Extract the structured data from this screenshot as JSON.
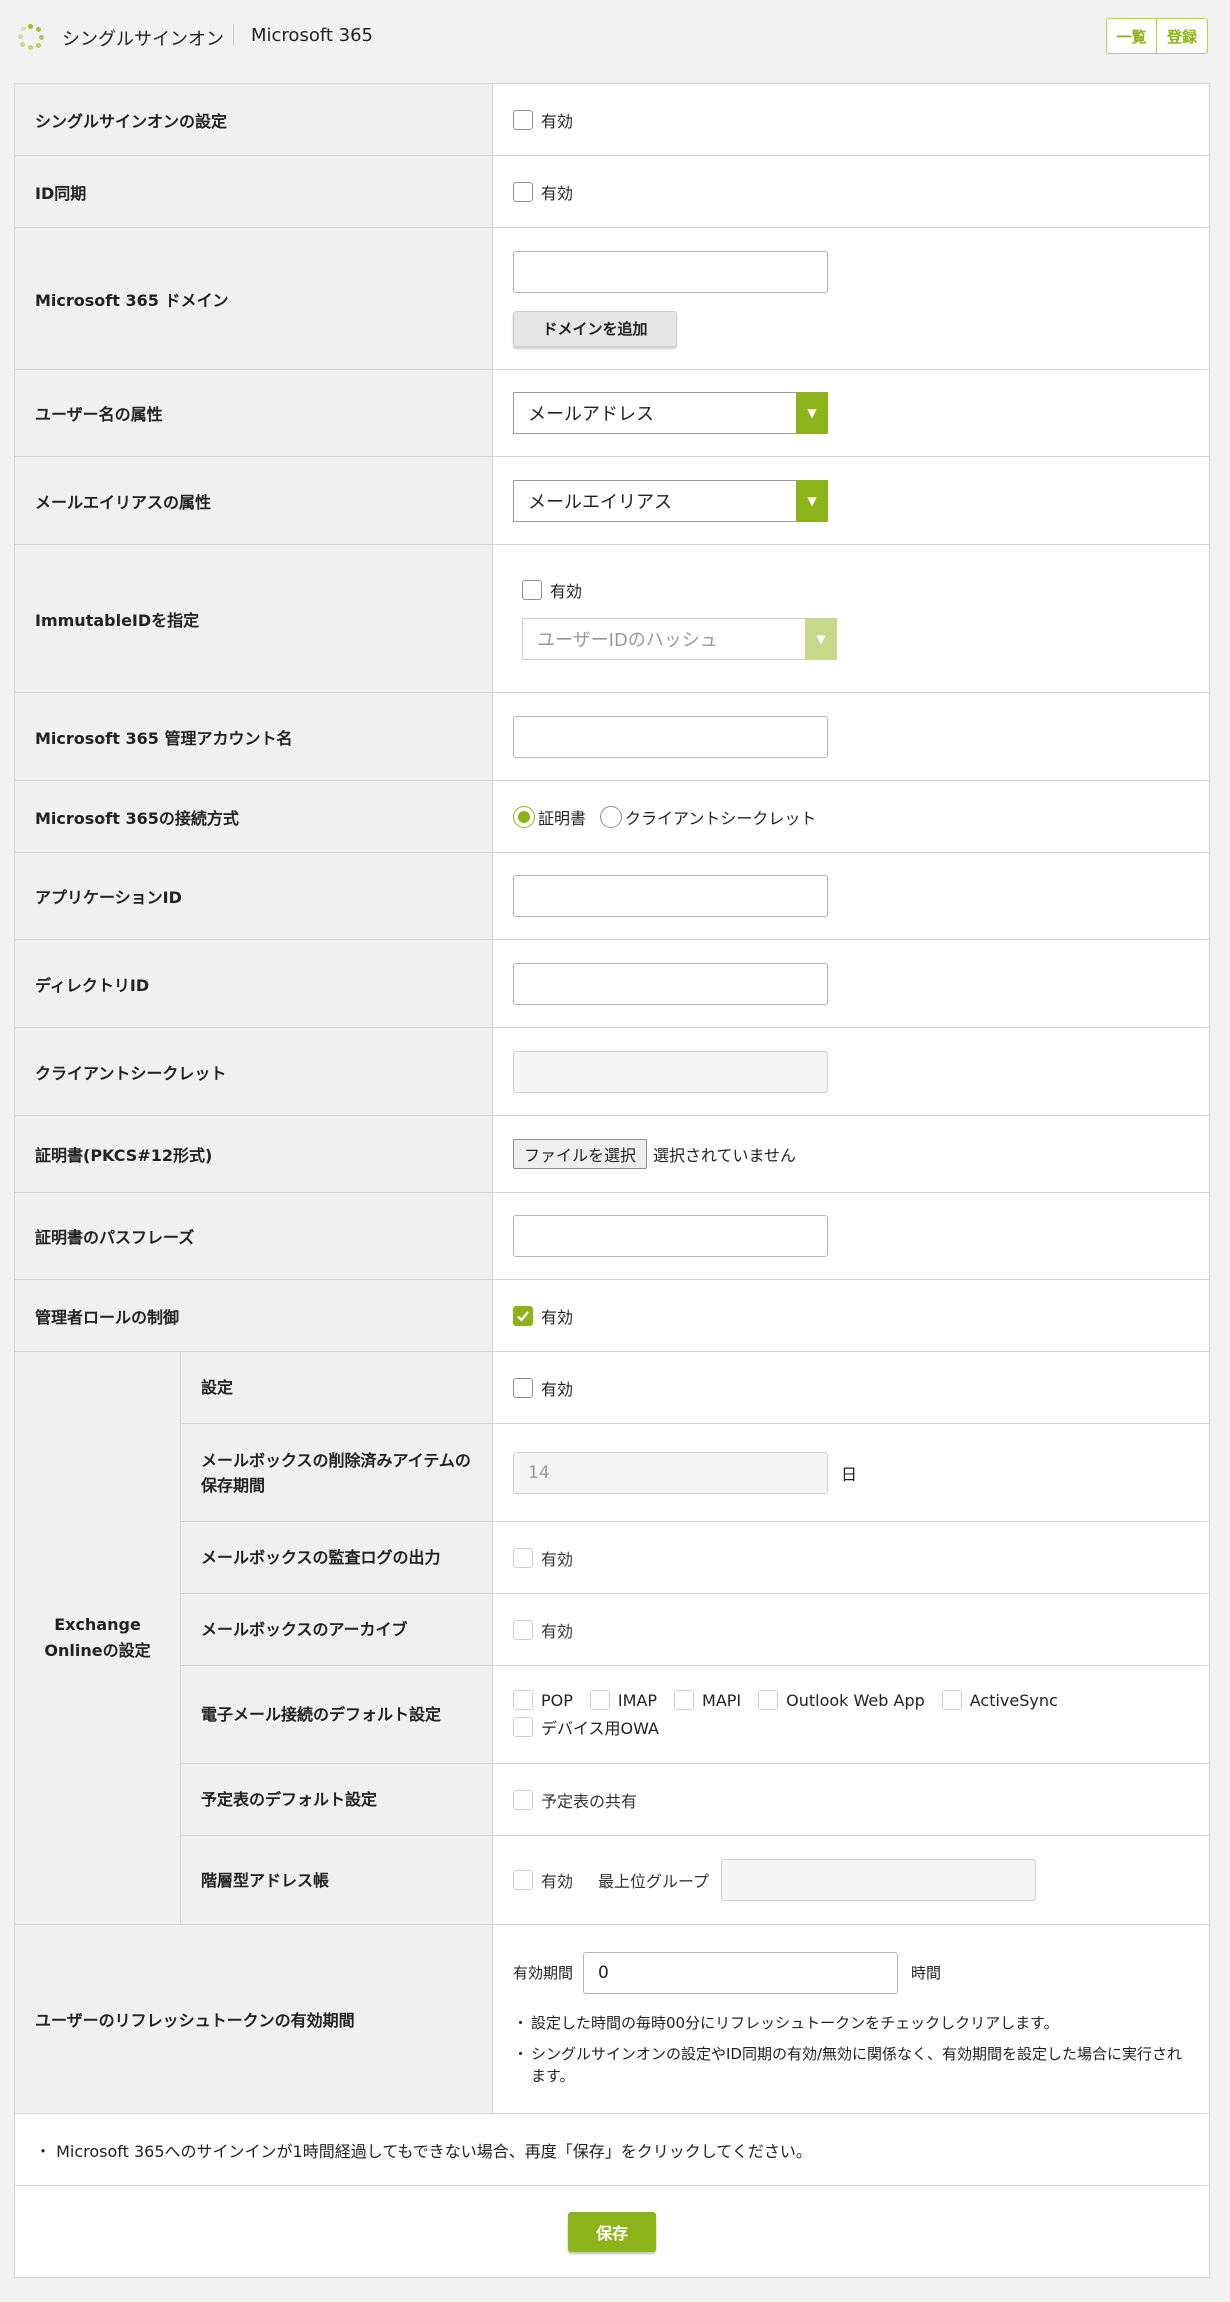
{
  "header": {
    "app_title": "シングルサインオン",
    "page_title": "Microsoft 365",
    "list_button": "一覧",
    "register_button": "登録"
  },
  "accent_color": "#8db31a",
  "rows": {
    "sso": {
      "label": "シングルサインオンの設定",
      "checkbox": "有効"
    },
    "id_sync": {
      "label": "ID同期",
      "checkbox": "有効"
    },
    "domain": {
      "label": "Microsoft 365 ドメイン",
      "value": "",
      "add_button": "ドメインを追加"
    },
    "username_attr": {
      "label": "ユーザー名の属性",
      "selected": "メールアドレス"
    },
    "mail_alias_attr": {
      "label": "メールエイリアスの属性",
      "selected": "メールエイリアス"
    },
    "immutable_id": {
      "label": "ImmutableIDを指定",
      "checkbox": "有効",
      "selected": "ユーザーIDのハッシュ"
    },
    "admin_account": {
      "label": "Microsoft 365 管理アカウント名",
      "value": ""
    },
    "connection": {
      "label": "Microsoft 365の接続方式",
      "option_cert": "証明書",
      "option_secret": "クライアントシークレット"
    },
    "app_id": {
      "label": "アプリケーションID",
      "value": ""
    },
    "directory_id": {
      "label": "ディレクトリID",
      "value": ""
    },
    "client_secret": {
      "label": "クライアントシークレット",
      "value": ""
    },
    "certificate": {
      "label": "証明書(PKCS#12形式)",
      "file_button": "ファイルを選択",
      "file_status": "選択されていません"
    },
    "passphrase": {
      "label": "証明書のパスフレーズ",
      "value": ""
    },
    "admin_role": {
      "label": "管理者ロールの制御",
      "checkbox": "有効"
    }
  },
  "exchange": {
    "group_label": "Exchange Onlineの設定",
    "settings": {
      "label": "設定",
      "checkbox": "有効"
    },
    "retention": {
      "label": "メールボックスの削除済みアイテムの保存期間",
      "value": "14",
      "unit": "日"
    },
    "audit_log": {
      "label": "メールボックスの監査ログの出力",
      "checkbox": "有効"
    },
    "archive": {
      "label": "メールボックスのアーカイブ",
      "checkbox": "有効"
    },
    "email_conn": {
      "label": "電子メール接続のデフォルト設定",
      "options": [
        "POP",
        "IMAP",
        "MAPI",
        "Outlook Web App",
        "ActiveSync",
        "デバイス用OWA"
      ]
    },
    "calendar": {
      "label": "予定表のデフォルト設定",
      "checkbox": "予定表の共有"
    },
    "address_book": {
      "label": "階層型アドレス帳",
      "checkbox": "有効",
      "top_group_label": "最上位グループ",
      "top_group_value": ""
    }
  },
  "refresh_token": {
    "label": "ユーザーのリフレッシュトークンの有効期間",
    "period_label": "有効期間",
    "value": "0",
    "unit": "時間",
    "note1": "設定した時間の毎時00分にリフレッシュトークンをチェックしクリアします。",
    "note2": "シングルサインオンの設定やID同期の有効/無効に関係なく、有効期間を設定した場合に実行されます。"
  },
  "footer": {
    "note": "・ Microsoft 365へのサインインが1時間経過してもできない場合、再度「保存」をクリックしてください。",
    "save_button": "保存"
  }
}
